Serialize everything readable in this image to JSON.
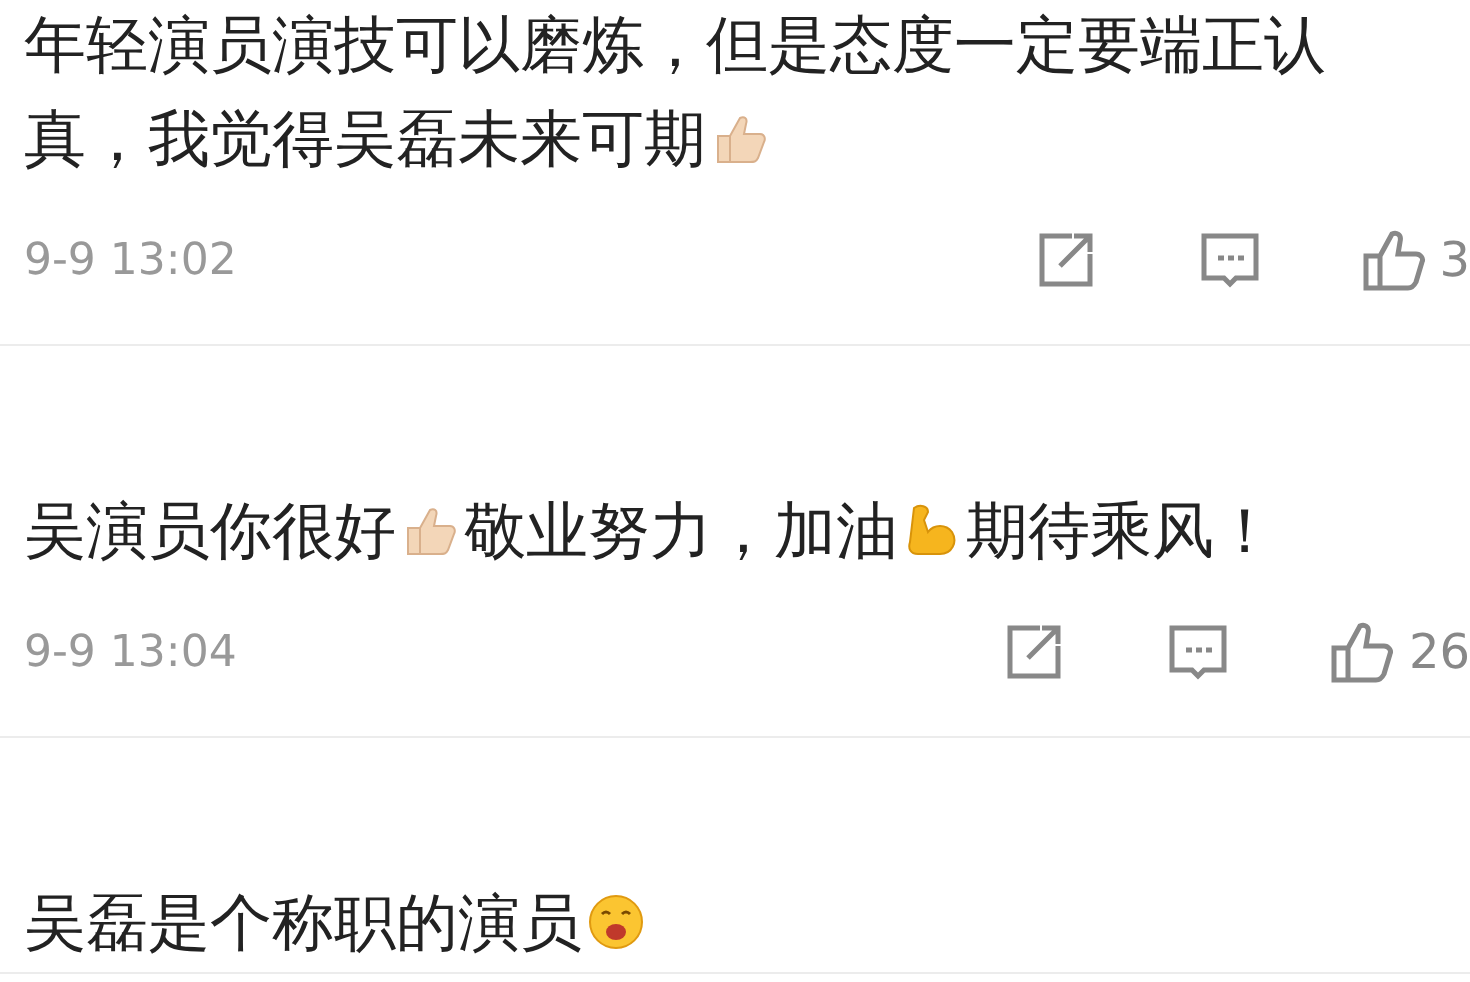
{
  "comments": [
    {
      "segments": [
        {
          "kind": "text",
          "text": "年轻演员演技可以磨炼，但是态度一定要端正认真，我觉得吴磊未来可期"
        },
        {
          "kind": "thumb"
        }
      ],
      "time": "9-9 13:02",
      "likes": "3"
    },
    {
      "segments": [
        {
          "kind": "text",
          "text": "吴演员你很好"
        },
        {
          "kind": "thumb"
        },
        {
          "kind": "text",
          "text": "敬业努力，加油"
        },
        {
          "kind": "flex"
        },
        {
          "kind": "text",
          "text": "期待乘风！"
        }
      ],
      "time": "9-9 13:04",
      "likes": "26"
    },
    {
      "segments": [
        {
          "kind": "text",
          "text": "吴磊是个称职的演员"
        },
        {
          "kind": "face"
        }
      ]
    }
  ]
}
